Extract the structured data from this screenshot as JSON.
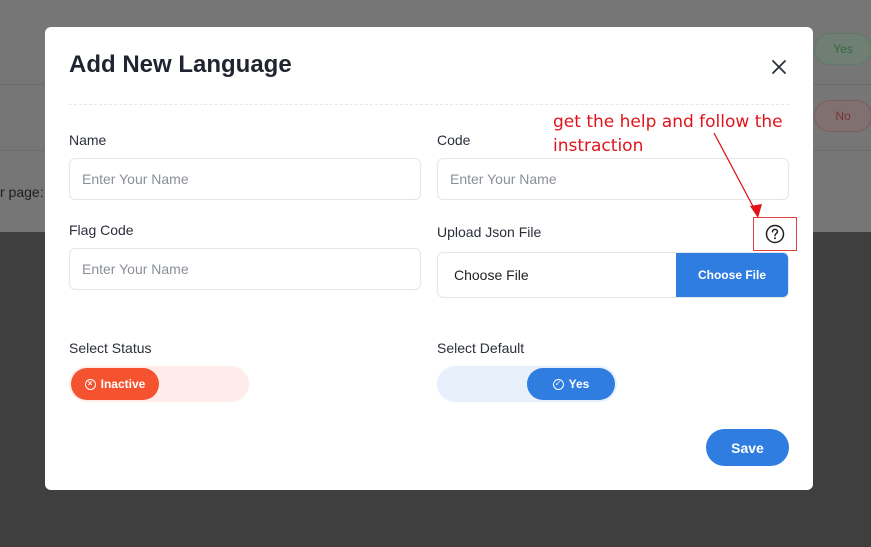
{
  "background": {
    "side_text": "r page:",
    "badge_yes": "Yes",
    "badge_no": "No"
  },
  "modal": {
    "title": "Add New Language",
    "close_icon": "close-icon",
    "fields": {
      "name": {
        "label": "Name",
        "placeholder": "Enter Your Name",
        "value": ""
      },
      "code": {
        "label": "Code",
        "placeholder": "Enter Your Name",
        "value": ""
      },
      "flag_code": {
        "label": "Flag Code",
        "placeholder": "Enter Your Name",
        "value": ""
      },
      "upload": {
        "label": "Upload Json File",
        "file_text": "Choose File",
        "button_label": "Choose File"
      }
    },
    "help_icon": "help-circle-icon",
    "annotation": "get the help and follow the instraction",
    "status": {
      "label": "Select Status",
      "value": "Inactive",
      "icon": "x-circle-icon",
      "color": "#f5532f"
    },
    "default": {
      "label": "Select Default",
      "value": "Yes",
      "icon": "check-circle-icon",
      "color": "#2f7de1"
    },
    "save_label": "Save"
  },
  "colors": {
    "accent": "#2f7de1",
    "danger": "#f5532f",
    "annotation": "#e0141a"
  }
}
